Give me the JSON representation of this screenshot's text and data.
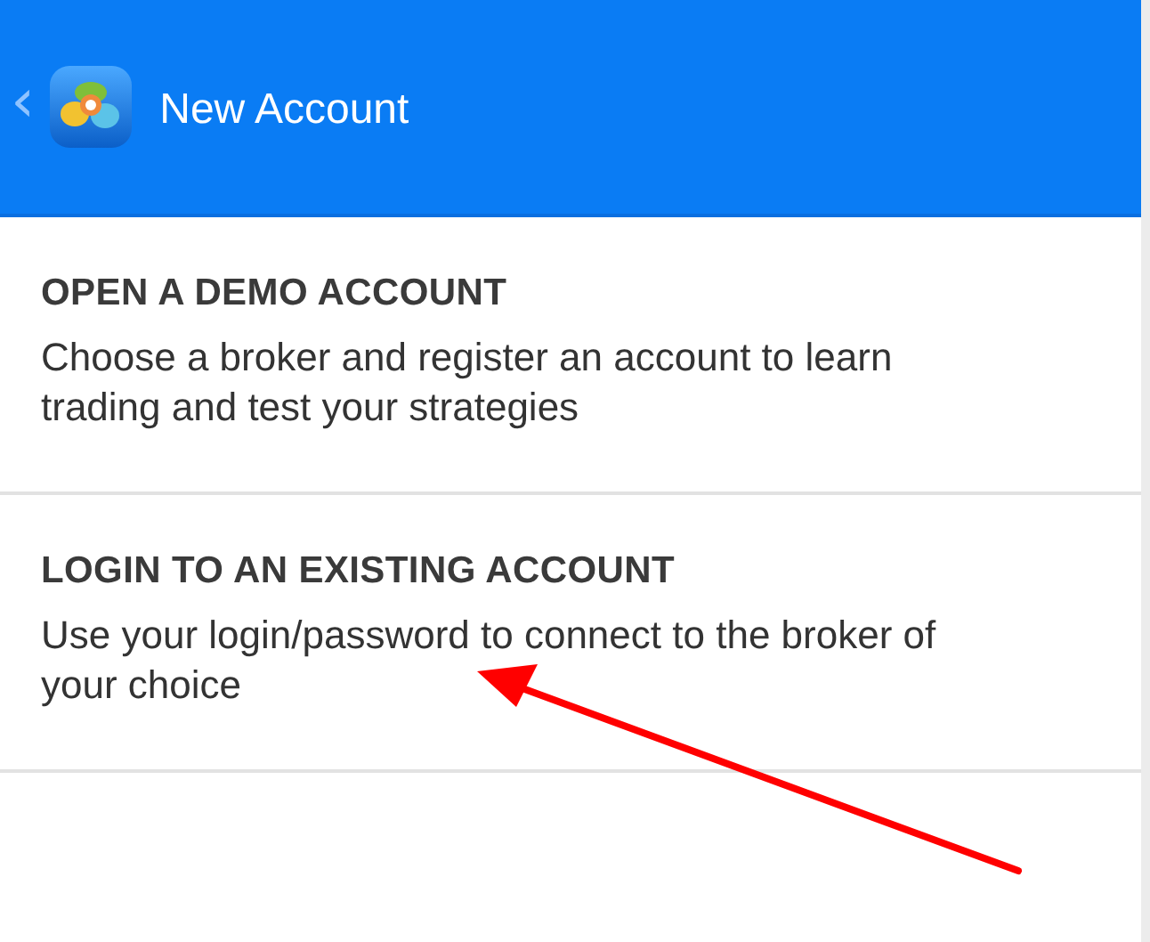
{
  "header": {
    "back": "‹",
    "title": "New Account"
  },
  "options": [
    {
      "title": "OPEN A DEMO ACCOUNT",
      "description": "Choose a broker and register an account to learn trading and test your strategies"
    },
    {
      "title": "LOGIN TO AN EXISTING ACCOUNT",
      "description": "Use your login/password to connect to the broker of your choice"
    }
  ]
}
